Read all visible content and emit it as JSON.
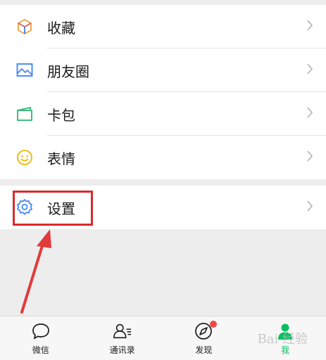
{
  "menu": {
    "items": [
      {
        "label": "收藏",
        "icon": "favorites-icon"
      },
      {
        "label": "朋友圈",
        "icon": "moments-icon"
      },
      {
        "label": "卡包",
        "icon": "card-package-icon"
      },
      {
        "label": "表情",
        "icon": "sticker-icon"
      }
    ],
    "settings": {
      "label": "设置",
      "icon": "gear-icon"
    }
  },
  "tabbar": {
    "tabs": [
      {
        "label": "微信",
        "icon": "chat-icon"
      },
      {
        "label": "通讯录",
        "icon": "contacts-icon"
      },
      {
        "label": "发现",
        "icon": "discover-icon",
        "badge": true
      },
      {
        "label": "我",
        "icon": "me-icon",
        "active": true
      }
    ]
  },
  "watermark": "Bai 经验",
  "colors": {
    "accent": "#07c160",
    "highlight": "#d92a2a",
    "badge": "#f04848"
  }
}
